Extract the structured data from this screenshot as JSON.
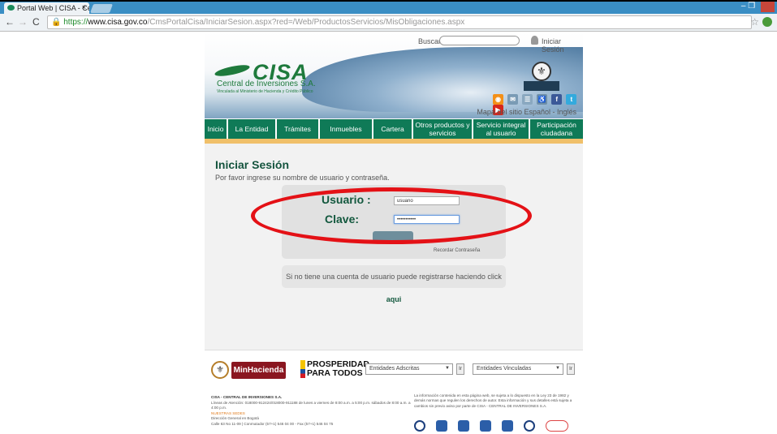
{
  "browser": {
    "tab_title": "Portal Web | CISA - Centr",
    "tab_close": "×",
    "url_prefix": "https://",
    "url_host": "www.cisa.gov.co",
    "url_path": "/CmsPortalCisa/IniciarSesion.aspx?red=/Web/ProductosServicios/MisObligaciones.aspx",
    "back_icon": "arrow-left-icon",
    "forward_icon": "arrow-right-icon",
    "reload_icon": "reload-icon",
    "star_icon": "star-icon"
  },
  "header": {
    "search_label": "Buscar",
    "login_label": "Iniciar Sesión",
    "logo_name": "CISA",
    "logo_subtitle": "Central de Inversiones S.A.",
    "logo_tagline": "Vinculada al Ministerio de Hacienda y Crédito Público",
    "sitemap_links": "Mapa del sitio Español - Inglés"
  },
  "menu": {
    "items": [
      {
        "label": "Inicio"
      },
      {
        "label": "La Entidad"
      },
      {
        "label": "Trámites"
      },
      {
        "label": "Inmuebles"
      },
      {
        "label": "Cartera"
      },
      {
        "label": "Otros productos y servicios"
      },
      {
        "label": "Servicio integral al usuario"
      },
      {
        "label": "Participación ciudadana"
      }
    ]
  },
  "login": {
    "title": "Iniciar Sesión",
    "description": "Por favor ingrese su nombre de usuario y contraseña.",
    "user_label": "Usuario :",
    "user_value": "usuario",
    "password_label": "Clave:",
    "password_value": "•••••••••••",
    "recover_label": "Recordar Contraseña",
    "register_text": "Si no tiene una cuenta de usuario puede registrarse haciendo click ",
    "register_link": "aqui"
  },
  "footer": {
    "minhacienda": "MinHacienda",
    "prosperidad_1": "PROSPERIDAD",
    "prosperidad_2": "PARA TODOS",
    "select_adscritas": "Entidades Adscritas",
    "select_vinculadas": "Entidades Vinculadas",
    "go_label": "Ir",
    "org_name": "CISA - CENTRAL DE INVERSIONES S.A.",
    "hours": "Líneas de Atención: 018000-912424/018000-911188 de lunes a viernes de 8:00 a.m. a 5:00 p.m. sábados de 8:00 a.m. a 4:00 p.m.",
    "branches": "NUESTRAS SEDES",
    "hq": "Dirección General en Bogotá",
    "address": "Calle 63 No 11-09 | Conmutador (57+1) 546 04 00 - Fax (57+1) 546 04 75",
    "legal": "La información contenida en esta página web, se sujeta a lo dispuesto en la Ley 23 de 1982 y demás normas que regulen los derechos de autor. Esta información y sus detalles está sujeta a cambios sin previo aviso por parte de CISA - CENTRAL DE INVERSIONES S.A."
  },
  "colors": {
    "brand_green": "#0f7a57",
    "accent_orange": "#f0c06a",
    "annotation_red": "#e41116"
  }
}
